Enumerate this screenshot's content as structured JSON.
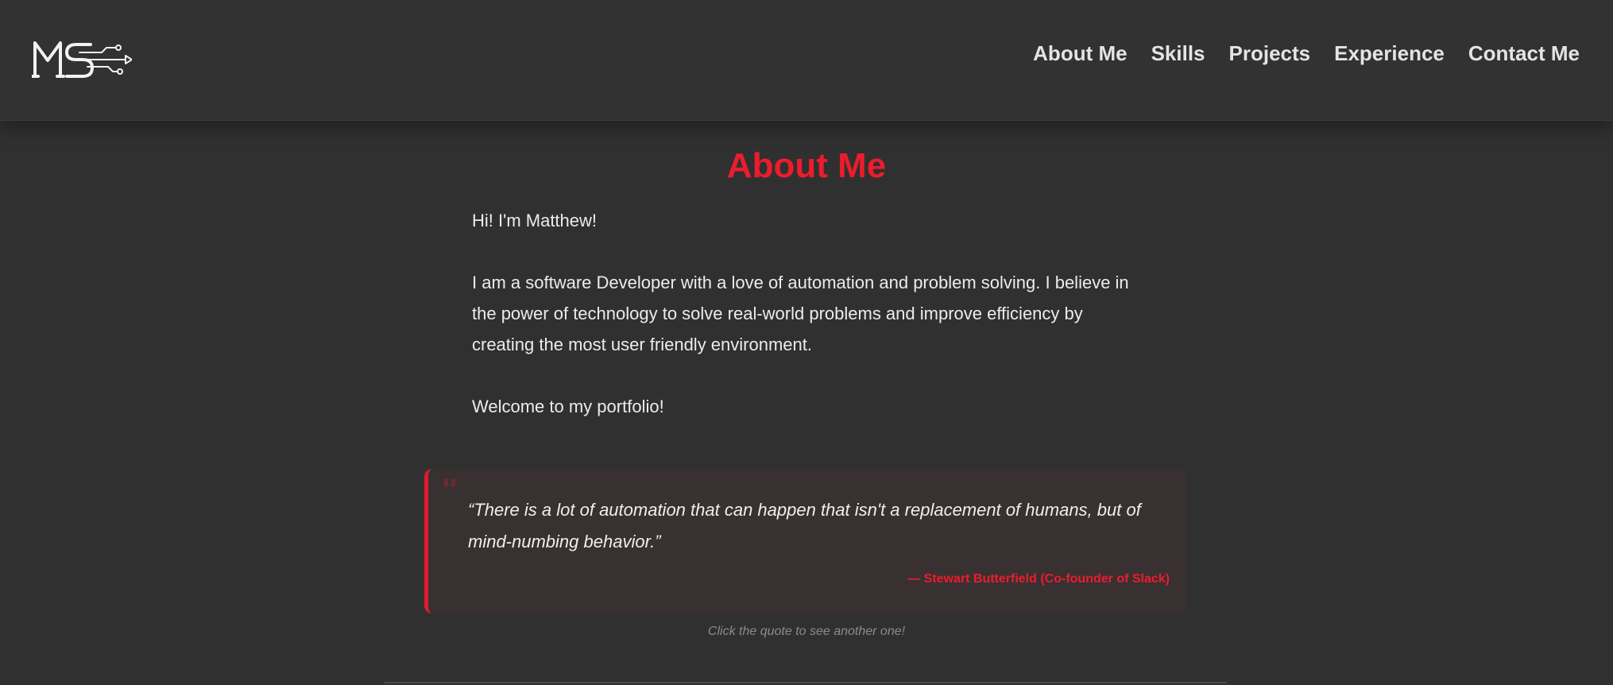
{
  "header": {
    "logo_text": "MS",
    "nav": [
      {
        "label": "About Me"
      },
      {
        "label": "Skills"
      },
      {
        "label": "Projects"
      },
      {
        "label": "Experience"
      },
      {
        "label": "Contact Me"
      }
    ]
  },
  "about": {
    "title": "About Me",
    "paragraphs": [
      "Hi! I'm Matthew!",
      "I am a software Developer with a love of automation and problem solving. I believe in the power of technology to solve real-world problems and improve efficiency by creating the most user friendly environment.",
      "Welcome to my portfolio!"
    ]
  },
  "quote": {
    "mark": "\"",
    "text": "“There is a lot of automation that can happen that isn't a replacement of humans, but of mind-numbing behavior.”",
    "author": "— Stewart Butterfield (Co-founder of Slack)",
    "hint": "Click the quote to see another one!"
  },
  "colors": {
    "accent": "#ec1c2d",
    "background": "#303030",
    "header": "#323232",
    "quote_card": "#393031"
  }
}
